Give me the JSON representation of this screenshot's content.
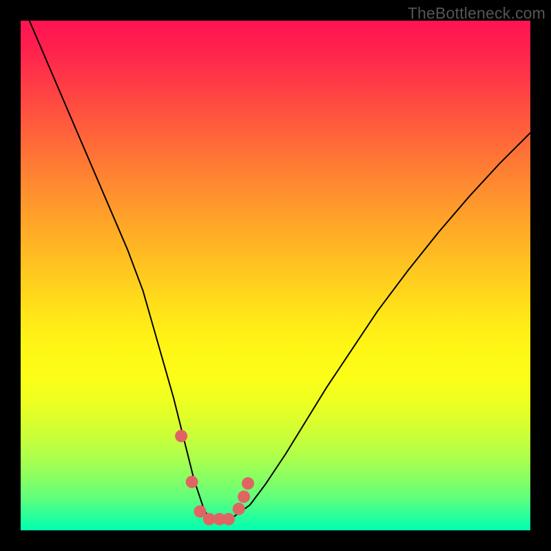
{
  "watermark": "TheBottleneck.com",
  "chart_data": {
    "type": "line",
    "title": "",
    "xlabel": "",
    "ylabel": "",
    "xlim": [
      0,
      100
    ],
    "ylim": [
      0,
      100
    ],
    "series": [
      {
        "name": "curve",
        "x": [
          0,
          3,
          6,
          9,
          12,
          15,
          18,
          21,
          24,
          26,
          28,
          30,
          31,
          32,
          33,
          34,
          35,
          36,
          37,
          38,
          39,
          40,
          42,
          45,
          48,
          52,
          56,
          60,
          65,
          70,
          76,
          82,
          88,
          94,
          100
        ],
        "y": [
          104,
          97,
          90,
          83,
          76,
          69,
          62,
          55,
          47,
          40,
          33,
          26,
          22,
          18,
          14,
          10,
          7,
          4,
          2.5,
          2,
          2,
          2,
          2.8,
          5,
          9,
          15,
          21.5,
          28,
          35.5,
          43,
          51,
          58.5,
          65.5,
          72,
          78
        ]
      },
      {
        "name": "dots",
        "x": [
          31.5,
          33.6,
          35.2,
          37.0,
          39.0,
          40.8,
          42.8,
          43.8,
          44.6
        ],
        "y": [
          18.5,
          9.5,
          3.7,
          2.2,
          2.2,
          2.2,
          4.2,
          6.6,
          9.2
        ]
      }
    ],
    "colors": {
      "curve_stroke": "#000000",
      "dot_fill": "#e06464"
    }
  }
}
